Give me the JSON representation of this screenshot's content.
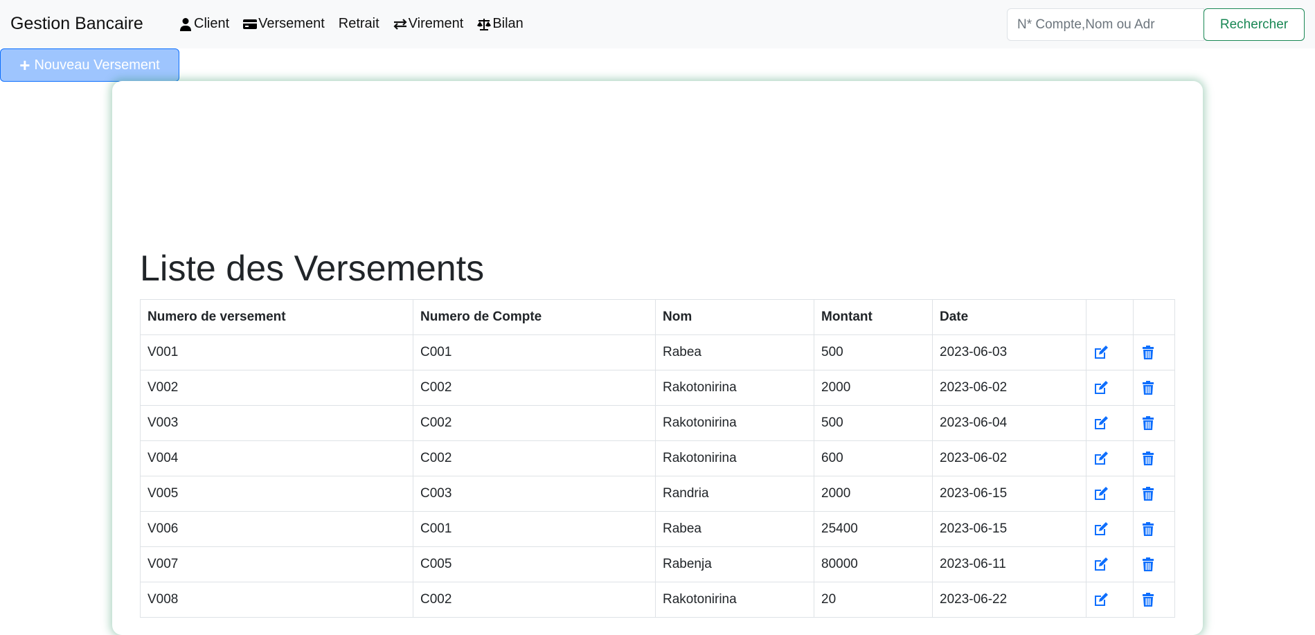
{
  "navbar": {
    "brand": "Gestion Bancaire",
    "links": [
      {
        "label": "Client",
        "icon": "user-icon"
      },
      {
        "label": "Versement",
        "icon": "credit-card-icon"
      },
      {
        "label": "Retrait",
        "icon": ""
      },
      {
        "label": "Virement",
        "icon": "exchange-icon"
      },
      {
        "label": "Bilan",
        "icon": "balance-scale-icon"
      }
    ],
    "search_placeholder": "N* Compte,Nom ou Adr",
    "search_button": "Rechercher"
  },
  "new_button": "Nouveau Versement",
  "title": "Liste des Versements",
  "table": {
    "headers": [
      "Numero de versement",
      "Numero de Compte",
      "Nom",
      "Montant",
      "Date"
    ],
    "rows": [
      [
        "V001",
        "C001",
        "Rabea",
        "500",
        "2023-06-03"
      ],
      [
        "V002",
        "C002",
        "Rakotonirina",
        "2000",
        "2023-06-02"
      ],
      [
        "V003",
        "C002",
        "Rakotonirina",
        "500",
        "2023-06-04"
      ],
      [
        "V004",
        "C002",
        "Rakotonirina",
        "600",
        "2023-06-02"
      ],
      [
        "V005",
        "C003",
        "Randria",
        "2000",
        "2023-06-15"
      ],
      [
        "V006",
        "C001",
        "Rabea",
        "25400",
        "2023-06-15"
      ],
      [
        "V007",
        "C005",
        "Rabenja",
        "80000",
        "2023-06-11"
      ],
      [
        "V008",
        "C002",
        "Rakotonirina",
        "20",
        "2023-06-22"
      ]
    ]
  },
  "colors": {
    "accent": "#0d6efd",
    "success": "#198754"
  }
}
